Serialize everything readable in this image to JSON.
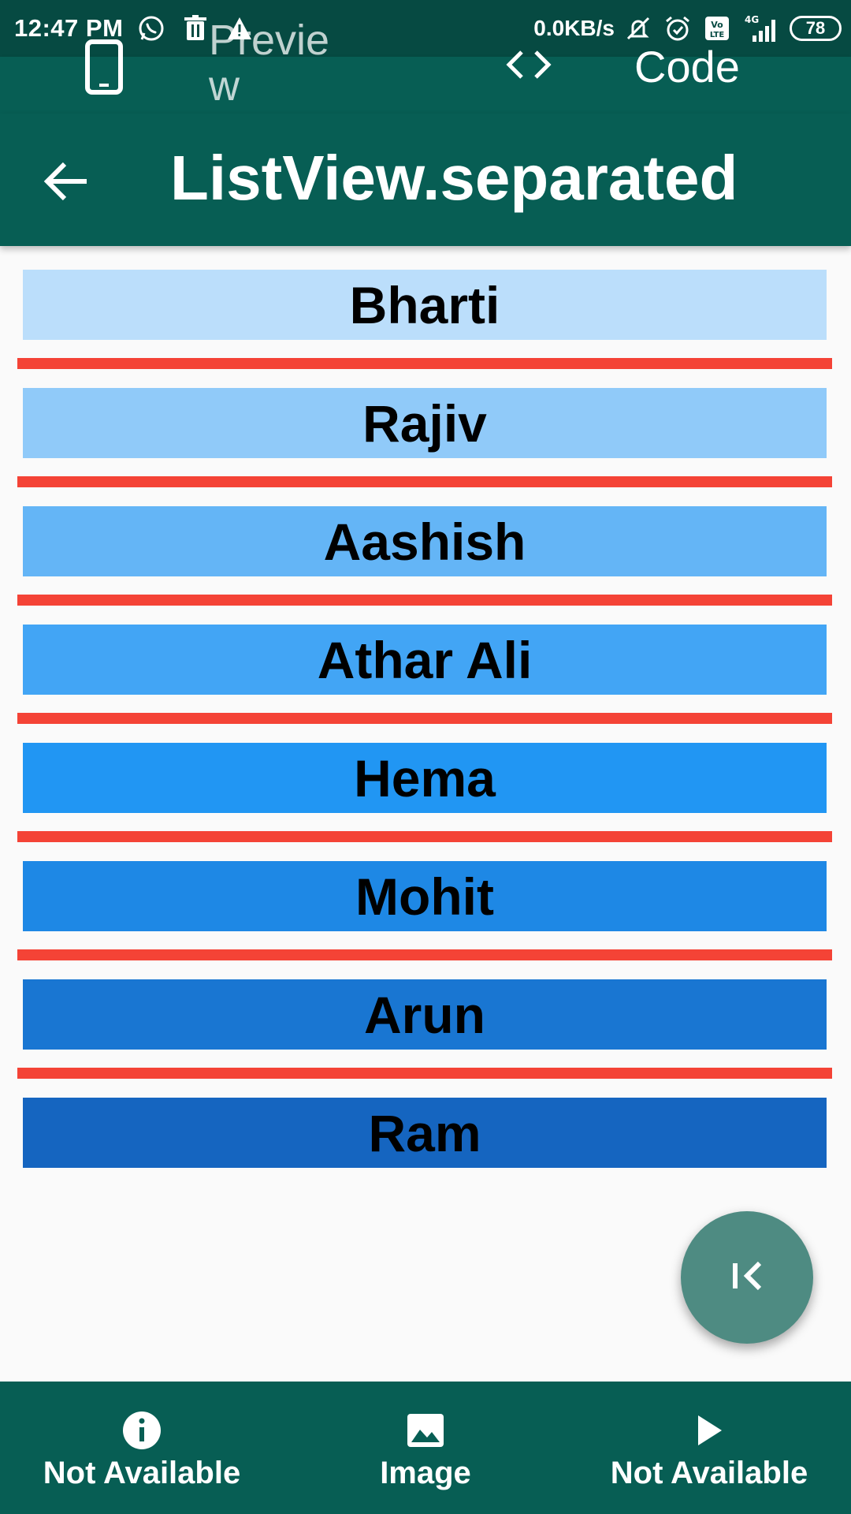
{
  "status_bar": {
    "time": "12:47 PM",
    "net_speed": "0.0KB/s",
    "battery": "78",
    "network_type": "4G",
    "icons": [
      "whatsapp-icon",
      "delete-icon",
      "warning-icon",
      "mute-icon",
      "alarm-icon",
      "volte-icon",
      "signal-icon",
      "battery-icon"
    ]
  },
  "switcher": {
    "preview_label": "Preview",
    "code_label": "Code"
  },
  "app_bar": {
    "title": "ListView.separated"
  },
  "list": {
    "items": [
      {
        "name": "Bharti",
        "color": "#bbdefb"
      },
      {
        "name": "Rajiv",
        "color": "#90caf9"
      },
      {
        "name": "Aashish",
        "color": "#64b5f6"
      },
      {
        "name": "Athar Ali",
        "color": "#42a5f5"
      },
      {
        "name": "Hema",
        "color": "#2196f3"
      },
      {
        "name": "Mohit",
        "color": "#1e88e5"
      },
      {
        "name": "Arun",
        "color": "#1976d2"
      },
      {
        "name": "Ram",
        "color": "#1565c0"
      }
    ],
    "separator_color": "#f44336"
  },
  "fab": {
    "icon": "first-page-icon"
  },
  "bottom_nav": {
    "items": [
      {
        "label": "Not Available",
        "icon": "info-icon"
      },
      {
        "label": "Image",
        "icon": "image-icon"
      },
      {
        "label": "Not Available",
        "icon": "play-icon"
      }
    ]
  },
  "colors": {
    "primary": "#075e54",
    "status_bar": "#064a42",
    "fab": "#4e8b82",
    "background": "#fafafa"
  }
}
